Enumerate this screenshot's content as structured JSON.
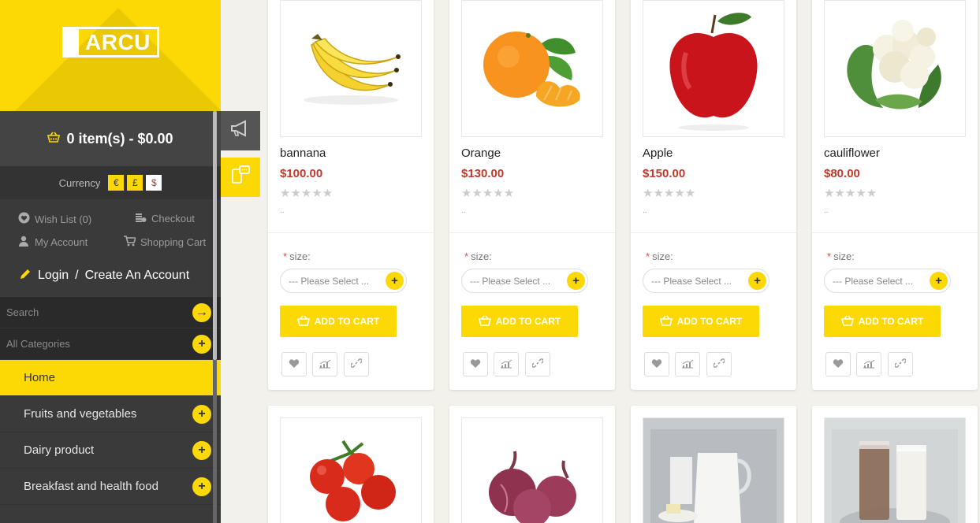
{
  "brand": {
    "logo_text": "ARCU"
  },
  "cart": {
    "summary": "0 item(s) - $0.00"
  },
  "currency": {
    "label": "Currency",
    "options": [
      "€",
      "£",
      "$"
    ],
    "selected": "$"
  },
  "links": {
    "wishlist": "Wish List (0)",
    "checkout": "Checkout",
    "my_account": "My Account",
    "shopping_cart": "Shopping Cart"
  },
  "auth": {
    "login": "Login",
    "separator": "/",
    "create_account": "Create An Account"
  },
  "search": {
    "placeholder": "Search"
  },
  "categories": {
    "label": "All Categories"
  },
  "menu": {
    "items": [
      {
        "label": "Home",
        "active": true
      },
      {
        "label": "Fruits and vegetables",
        "active": false
      },
      {
        "label": "Dairy product",
        "active": false
      },
      {
        "label": "Breakfast and health food",
        "active": false
      }
    ]
  },
  "products": [
    {
      "name": "bannana",
      "price": "$100.00",
      "stars": "★★★★★",
      "dots": "..",
      "size_label": "size:",
      "size_placeholder": "--- Please Select ...",
      "add_to_cart": "ADD TO CART",
      "image": "banana"
    },
    {
      "name": "Orange",
      "price": "$130.00",
      "stars": "★★★★★",
      "dots": "..",
      "size_label": "size:",
      "size_placeholder": "--- Please Select ...",
      "add_to_cart": "ADD TO CART",
      "image": "orange"
    },
    {
      "name": "Apple",
      "price": "$150.00",
      "stars": "★★★★★",
      "dots": "..",
      "size_label": "size:",
      "size_placeholder": "--- Please Select ...",
      "add_to_cart": "ADD TO CART",
      "image": "apple"
    },
    {
      "name": "cauliflower",
      "price": "$80.00",
      "stars": "★★★★★",
      "dots": "..",
      "size_label": "size:",
      "size_placeholder": "--- Please Select ...",
      "add_to_cart": "ADD TO CART",
      "image": "cauliflower"
    }
  ],
  "products_row2": [
    {
      "image": "tomato"
    },
    {
      "image": "onion"
    },
    {
      "image": "milk"
    },
    {
      "image": "chocolate-milk"
    }
  ],
  "colors": {
    "accent": "#fcd805",
    "price": "#c0392b",
    "sidebar": "#3a3a3a"
  }
}
